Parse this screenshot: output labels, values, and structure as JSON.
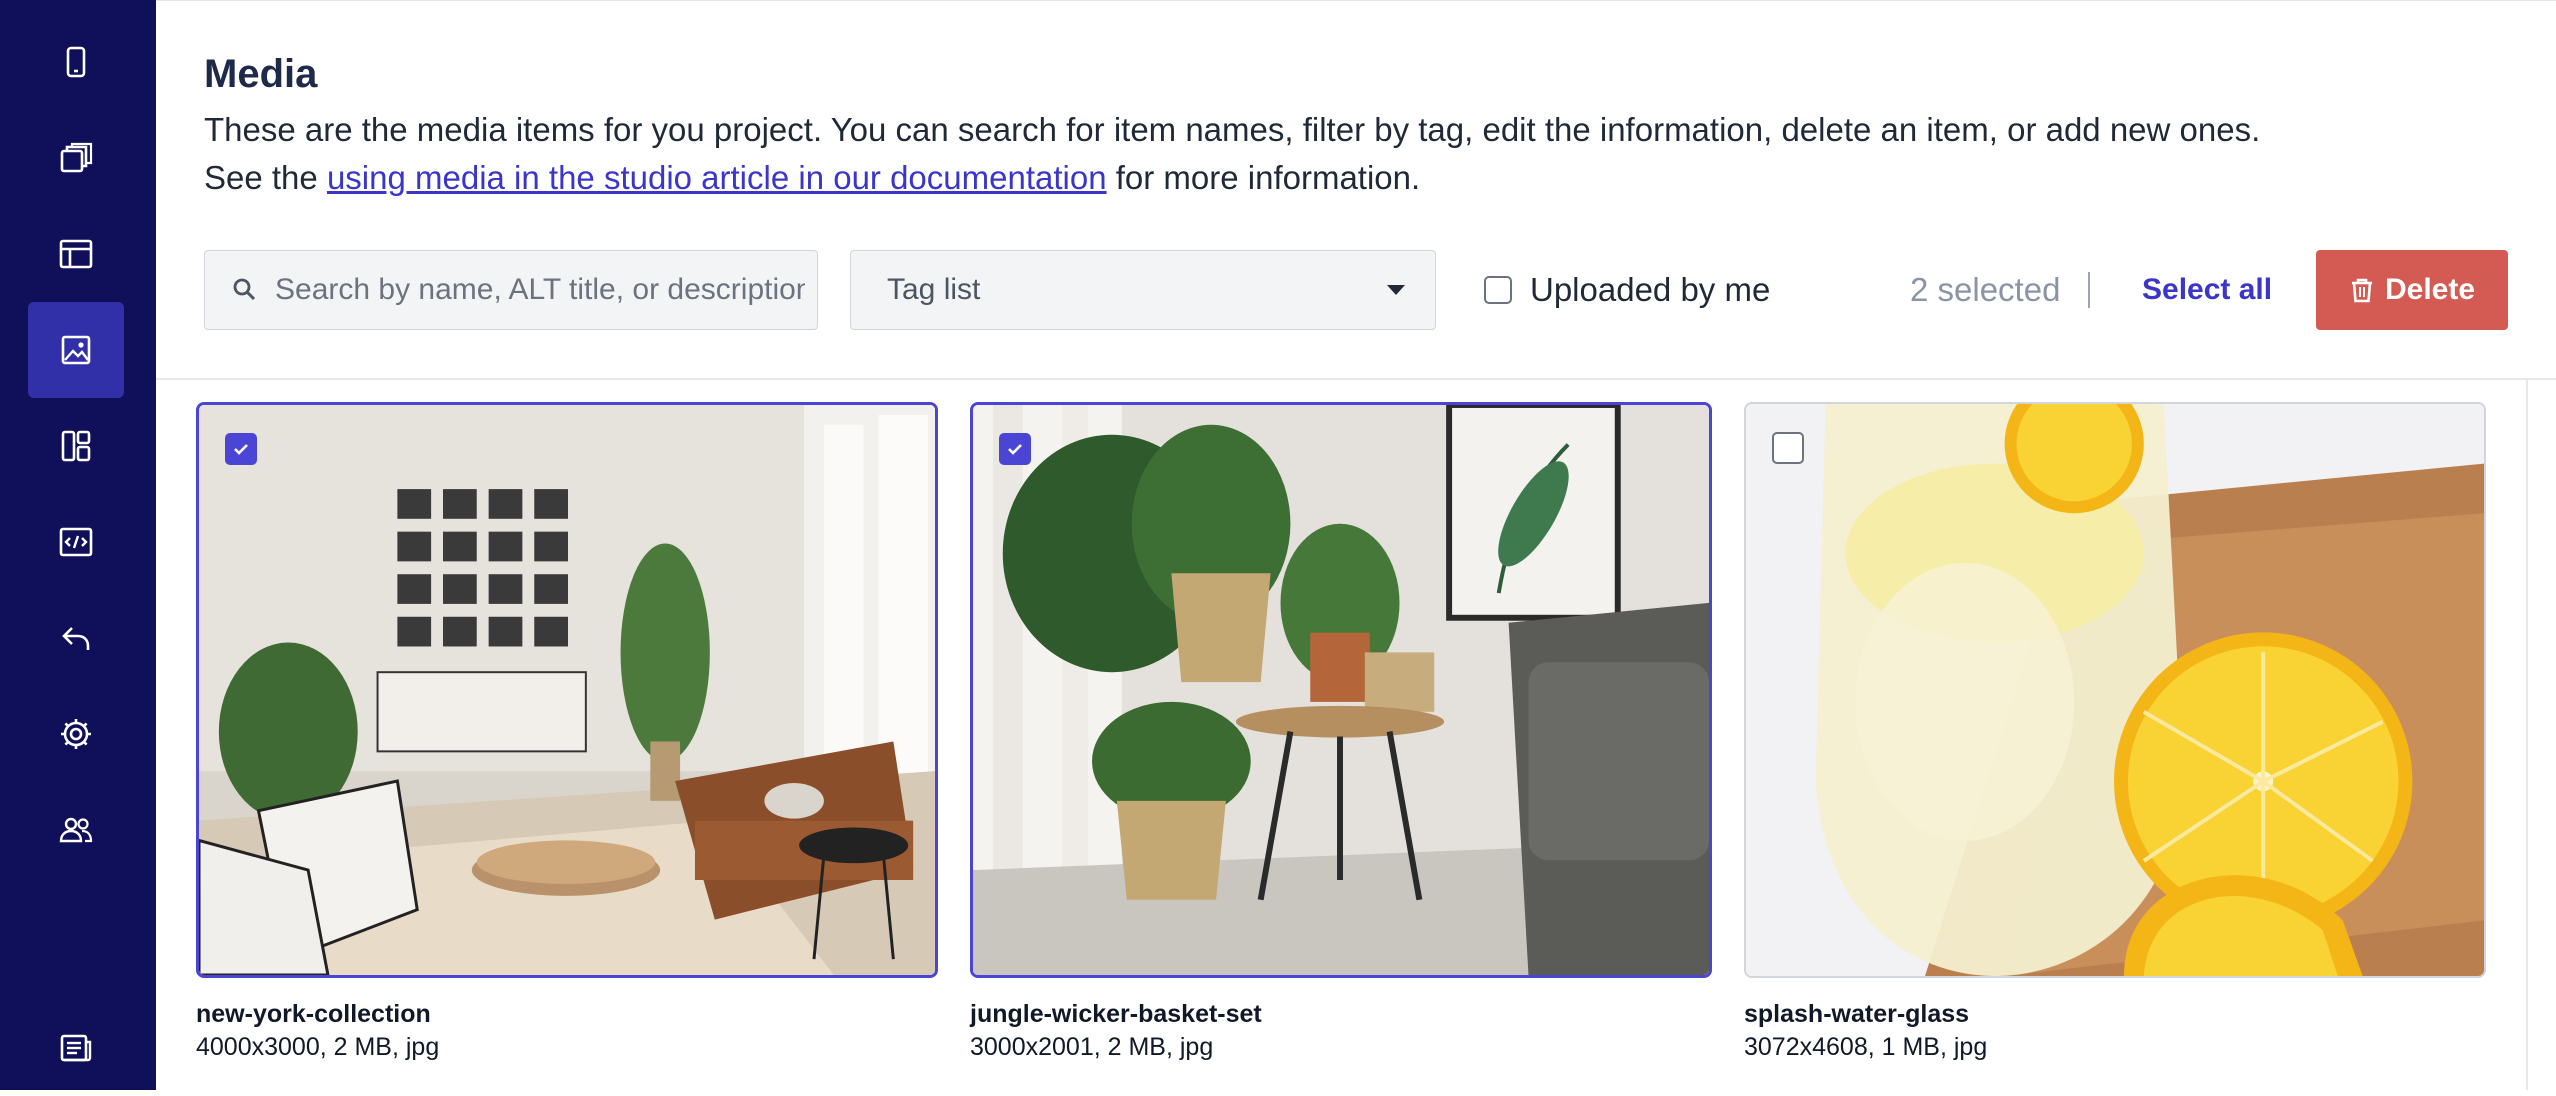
{
  "sidebar": {
    "items": [
      {
        "icon": "mobile-icon"
      },
      {
        "icon": "copy-icon"
      },
      {
        "icon": "layout-icon"
      },
      {
        "icon": "image-icon",
        "active": true
      },
      {
        "icon": "components-icon"
      },
      {
        "icon": "code-icon"
      },
      {
        "icon": "undo-arrow-icon"
      },
      {
        "icon": "gear-icon"
      },
      {
        "icon": "users-icon"
      },
      {
        "icon": "document-icon"
      }
    ]
  },
  "header": {
    "title": "Media",
    "description_line1": "These are the media items for you project. You can search for item names, filter by tag, edit the information, delete an item, or add new ones.",
    "description_prefix": "See the ",
    "description_link": "using media in the studio article in our documentation",
    "description_suffix": " for more information."
  },
  "toolbar": {
    "search_placeholder": "Search by name, ALT title, or description",
    "tag_list_label": "Tag list",
    "uploaded_by_me_label": "Uploaded by me",
    "selected_count": "2 selected",
    "select_all_label": "Select all",
    "delete_label": "Delete"
  },
  "media": [
    {
      "name": "new-york-collection",
      "meta": "4000x3000, 2 MB, jpg",
      "selected": true
    },
    {
      "name": "jungle-wicker-basket-set",
      "meta": "3000x2001, 2 MB, jpg",
      "selected": true
    },
    {
      "name": "splash-water-glass",
      "meta": "3072x4608, 1 MB, jpg",
      "selected": false
    }
  ],
  "colors": {
    "sidebar_bg": "#100f5a",
    "sidebar_active": "#3230a8",
    "accent": "#4b45d6",
    "link": "#3b35c9",
    "delete": "#d45b54"
  }
}
